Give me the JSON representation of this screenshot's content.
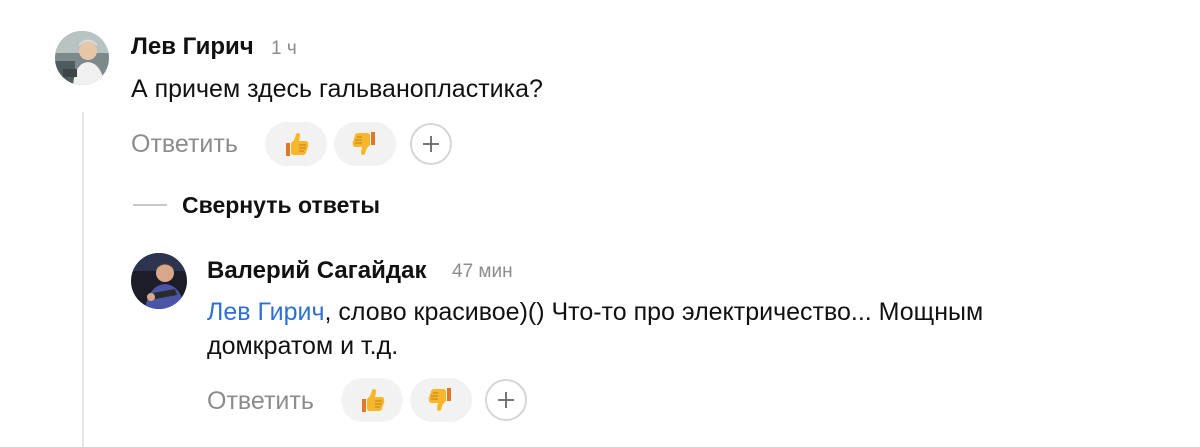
{
  "comments": [
    {
      "author": "Лев Гирич",
      "time": "1 ч",
      "text": "А причем здесь гальванопластика?",
      "reply_label": "Ответить",
      "avatar_icon": "user-avatar-photo"
    },
    {
      "author": "Валерий Сагайдак",
      "time": "47 мин",
      "mention": "Лев Гирич",
      "text_line1": ", слово красивое)() Что-то про электричество... Мощным",
      "text_line2": "домкратом и т.д.",
      "reply_label": "Ответить",
      "avatar_icon": "user-avatar-photo"
    }
  ],
  "thread": {
    "collapse_label": "Свернуть ответы"
  },
  "reactions": {
    "like_icon": "thumbs-up-icon",
    "dislike_icon": "thumbs-down-icon",
    "add_icon": "plus-icon"
  },
  "colors": {
    "mention": "#2f6fd6",
    "muted": "#8c8c8c",
    "reaction_bg": "#f2f2f2"
  }
}
